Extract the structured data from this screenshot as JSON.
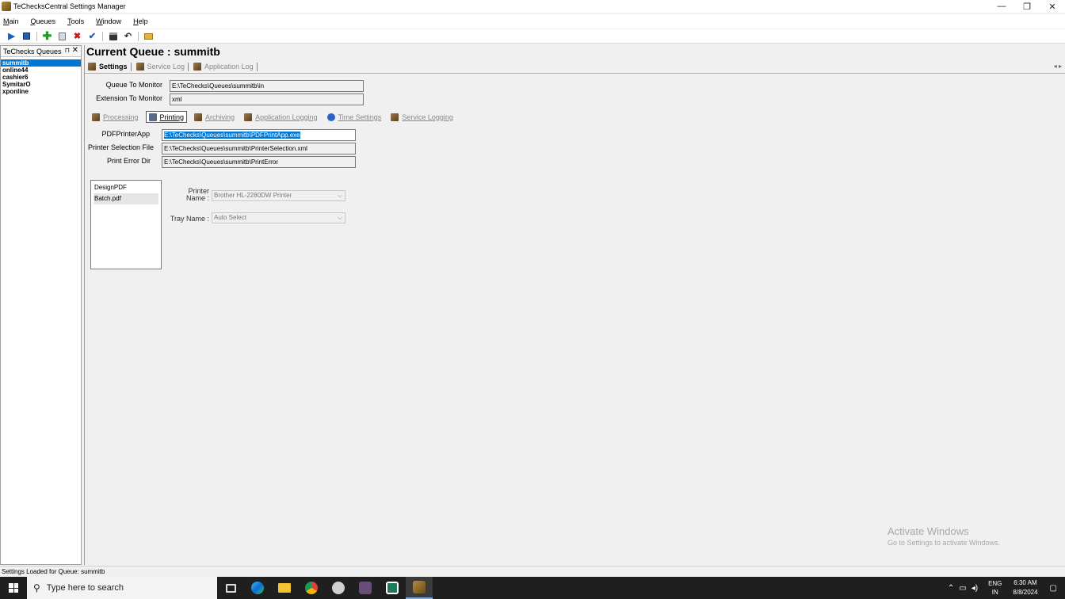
{
  "window": {
    "title": "TeChecksCentral Settings Manager",
    "minimize": "—",
    "restore": "❐",
    "close": "✕"
  },
  "menu": [
    "Main",
    "Queues",
    "Tools",
    "Window",
    "Help"
  ],
  "toolbar": {
    "icons": [
      "play-icon",
      "stop-icon",
      "add-icon",
      "edit-icon",
      "delete-icon",
      "check-icon",
      "save-icon",
      "undo-icon",
      "open-folder-icon"
    ]
  },
  "left_panel": {
    "title": "TeChecks Queues",
    "pin": "⊓",
    "close": "✕",
    "queues": [
      "summitb",
      "online44",
      "cashier6",
      "SymitarO",
      "xponline"
    ],
    "selected_index": 0
  },
  "main": {
    "current_queue": "Current Queue : summitb",
    "tabs": [
      "Settings",
      "Service Log",
      "Application Log"
    ],
    "tab_arrows": "◂ ▸",
    "queue_to_monitor_label": "Queue To Monitor",
    "queue_to_monitor_value": "E:\\TeChecks\\Queues\\summitb\\in",
    "extension_label": "Extension To Monitor",
    "extension_value": "xml",
    "subtabs": [
      "Processing",
      "Printing",
      "Archiving",
      "Application Logging",
      "Time Settings",
      "Service Logging"
    ],
    "active_subtab": "Printing",
    "pdf_printer_label": "PDFPrinterApp",
    "pdf_printer_value": "E:\\TeChecks\\Queues\\summitb\\PDFPrintApp.exe",
    "printer_selection_label": "Printer Selection File",
    "printer_selection_value": "E:\\TeChecks\\Queues\\summitb\\PrinterSelection.xml",
    "print_error_label": "Print Error Dir",
    "print_error_value": "E:\\TeChecks\\Queues\\summitb\\PrintError",
    "files": [
      "DesignPDF",
      "Batch.pdf"
    ],
    "printer_name_label_1": "Printer",
    "printer_name_label_2": "Name :",
    "printer_name_value": "Brother HL-2280DW Printer",
    "tray_name_label": "Tray Name :",
    "tray_name_value": "Auto Select"
  },
  "watermark": {
    "line1": "Activate Windows",
    "line2": "Go to Settings to activate Windows."
  },
  "status": "Settings Loaded for Queue: summitb",
  "taskbar": {
    "search_placeholder": "Type here to search",
    "lang_1": "ENG",
    "lang_2": "IN",
    "time": "6:30 AM",
    "date": "8/8/2024"
  }
}
